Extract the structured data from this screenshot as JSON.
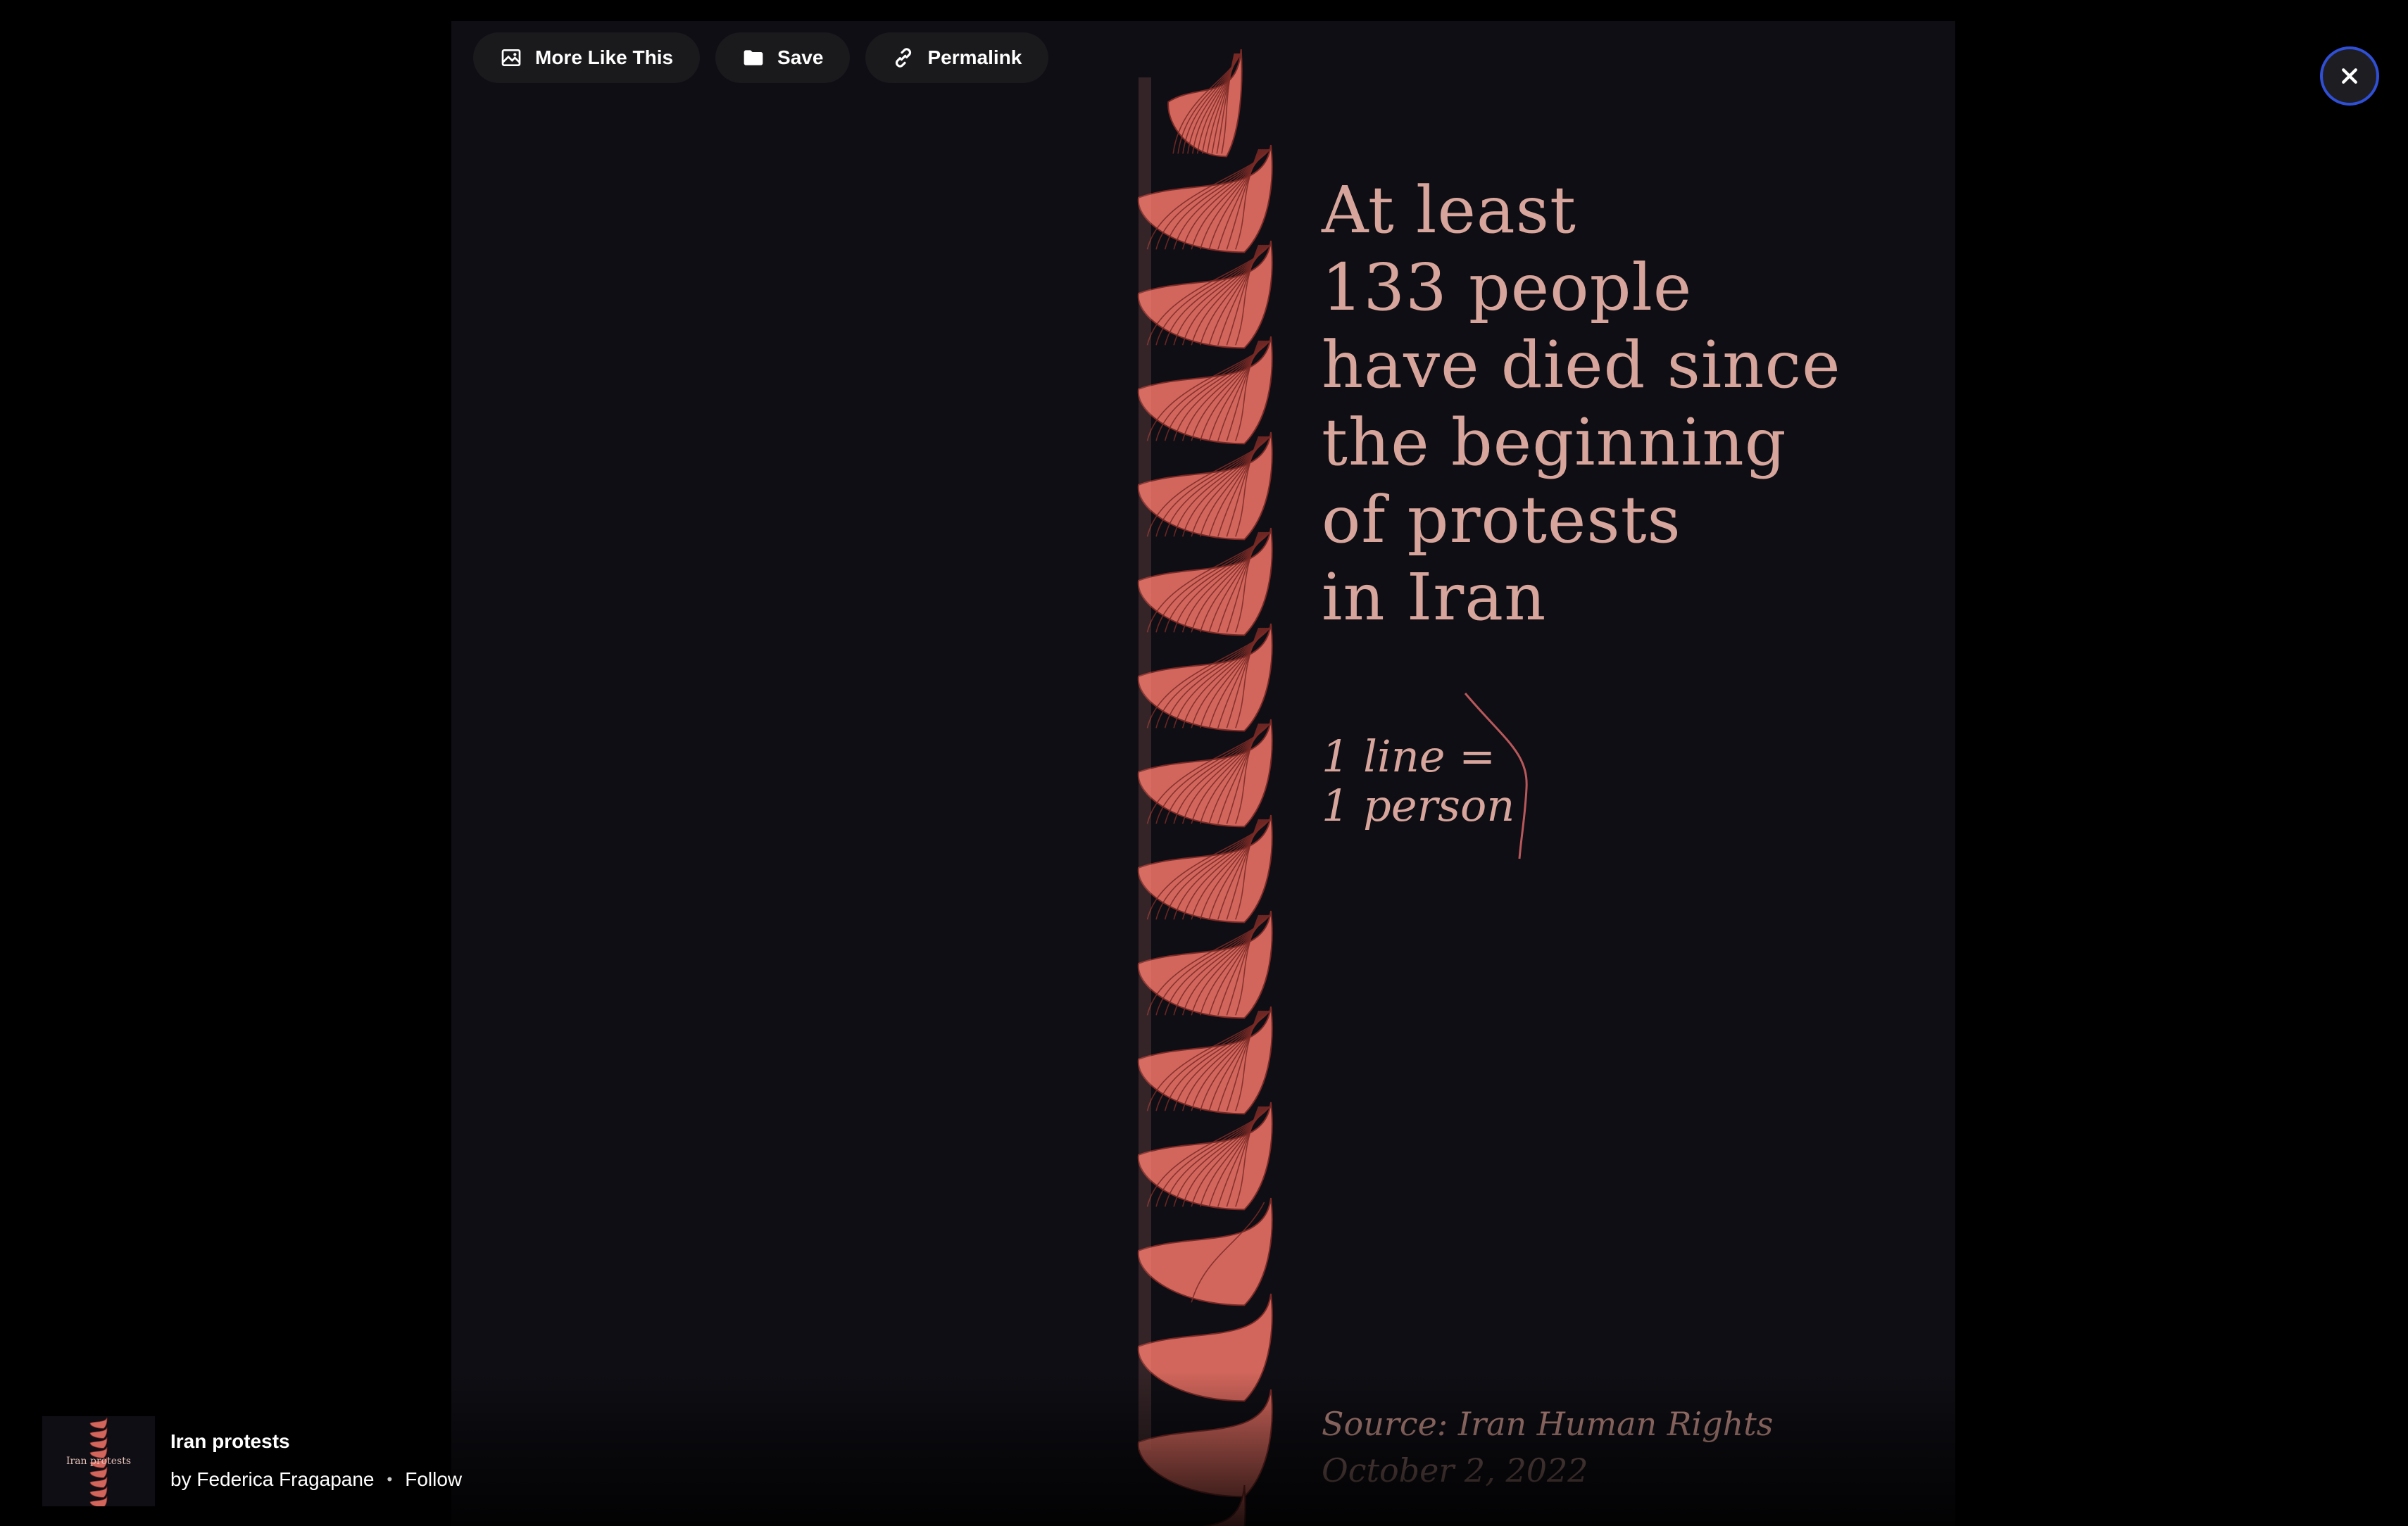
{
  "toolbar": {
    "more_like_this": {
      "label": "More Like This",
      "icon": "image-icon"
    },
    "save": {
      "label": "Save",
      "icon": "folder-icon"
    },
    "permalink": {
      "label": "Permalink",
      "icon": "link-icon"
    }
  },
  "close": {
    "icon": "close-icon"
  },
  "artwork": {
    "headline_lines": [
      "At least",
      "133 people",
      "have died since",
      "the beginning",
      "of protests",
      "in Iran"
    ],
    "legend_lines": [
      "1 line =",
      "1 person"
    ],
    "source": "Source: Iran Human Rights",
    "date": "October 2, 2022",
    "deaths_count": 133
  },
  "attribution": {
    "title": "Iran protests",
    "byline": "by Federica Fragapane",
    "separator": "•",
    "follow_label": "Follow",
    "thumbnail_caption": "Iran protests"
  },
  "colors": {
    "background": "#000000",
    "artwork_bg": "#0e0e14",
    "rope": "#d2665c",
    "rope_dark": "#7a2a26",
    "text_rose": "#d7a59b",
    "button_bg": "#1a1a1d",
    "close_ring": "#2f4fd6"
  }
}
